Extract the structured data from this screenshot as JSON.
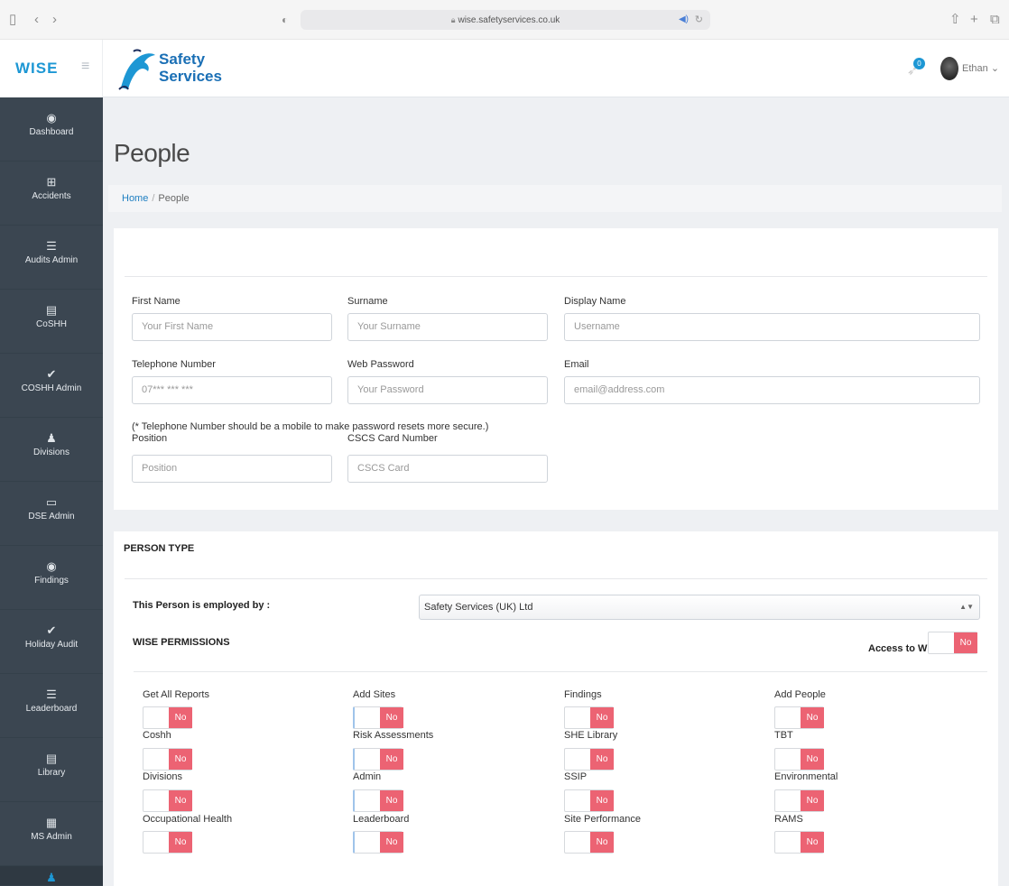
{
  "browser": {
    "url": "wise.safetyservices.co.uk"
  },
  "header": {
    "app_logo_main": "WISE",
    "company_line1": "Safety",
    "company_line2": "Services",
    "notification_count": "0",
    "user_name": "Ethan"
  },
  "sidebar": {
    "items": [
      {
        "label": "Dashboard",
        "icon": "dashboard-icon"
      },
      {
        "label": "Accidents",
        "icon": "first-aid-icon"
      },
      {
        "label": "Audits Admin",
        "icon": "list-icon"
      },
      {
        "label": "CoSHH",
        "icon": "book-icon"
      },
      {
        "label": "COSHH Admin",
        "icon": "check-icon"
      },
      {
        "label": "Divisions",
        "icon": "users-icon"
      },
      {
        "label": "DSE Admin",
        "icon": "monitor-icon"
      },
      {
        "label": "Findings",
        "icon": "eye-icon"
      },
      {
        "label": "Holiday Audit",
        "icon": "check-icon"
      },
      {
        "label": "Leaderboard",
        "icon": "list-icon"
      },
      {
        "label": "Library",
        "icon": "book-icon"
      },
      {
        "label": "MS Admin",
        "icon": "document-icon"
      },
      {
        "label": "",
        "icon": "users-icon"
      }
    ]
  },
  "page": {
    "title": "People",
    "breadcrumb_home": "Home",
    "breadcrumb_sep": "/",
    "breadcrumb_current": "People"
  },
  "form": {
    "first_name_label": "First Name",
    "first_name_placeholder": "Your First Name",
    "surname_label": "Surname",
    "surname_placeholder": "Your Surname",
    "display_name_label": "Display Name",
    "display_name_placeholder": "Username",
    "telephone_label": "Telephone Number",
    "telephone_value": "07*** *** ***",
    "password_label": "Web Password",
    "password_placeholder": "Your Password",
    "email_label": "Email",
    "email_placeholder": "email@address.com",
    "telephone_note": "(* Telephone Number should be a mobile to make password resets more secure.)",
    "position_label": "Position",
    "position_placeholder": "Position",
    "cscs_label": "CSCS Card Number",
    "cscs_placeholder": "CSCS Card"
  },
  "person_type": {
    "title": "PERSON TYPE",
    "employed_by_label": "This Person is employed by :",
    "employed_by_value": "Safety Services (UK) Ltd",
    "permissions_title": "WISE PERMISSIONS",
    "access_label": "Access to Wise",
    "access_value": "No"
  },
  "permissions": {
    "col1": [
      {
        "label": "Get All Reports",
        "value": "No"
      },
      {
        "label": "Coshh",
        "value": "No"
      },
      {
        "label": "Divisions",
        "value": "No"
      },
      {
        "label": "Occupational Health",
        "value": "No"
      }
    ],
    "col2": [
      {
        "label": "Add Sites",
        "value": "No"
      },
      {
        "label": "Risk Assessments",
        "value": "No"
      },
      {
        "label": "Admin",
        "value": "No"
      },
      {
        "label": "Leaderboard",
        "value": "No"
      }
    ],
    "col3": [
      {
        "label": "Findings",
        "value": "No"
      },
      {
        "label": "SHE Library",
        "value": "No"
      },
      {
        "label": "SSIP",
        "value": "No"
      },
      {
        "label": "Site Performance",
        "value": "No"
      }
    ],
    "col4": [
      {
        "label": "Add People",
        "value": "No"
      },
      {
        "label": "TBT",
        "value": "No"
      },
      {
        "label": "Environmental",
        "value": "No"
      },
      {
        "label": "RAMS",
        "value": "No"
      }
    ]
  }
}
